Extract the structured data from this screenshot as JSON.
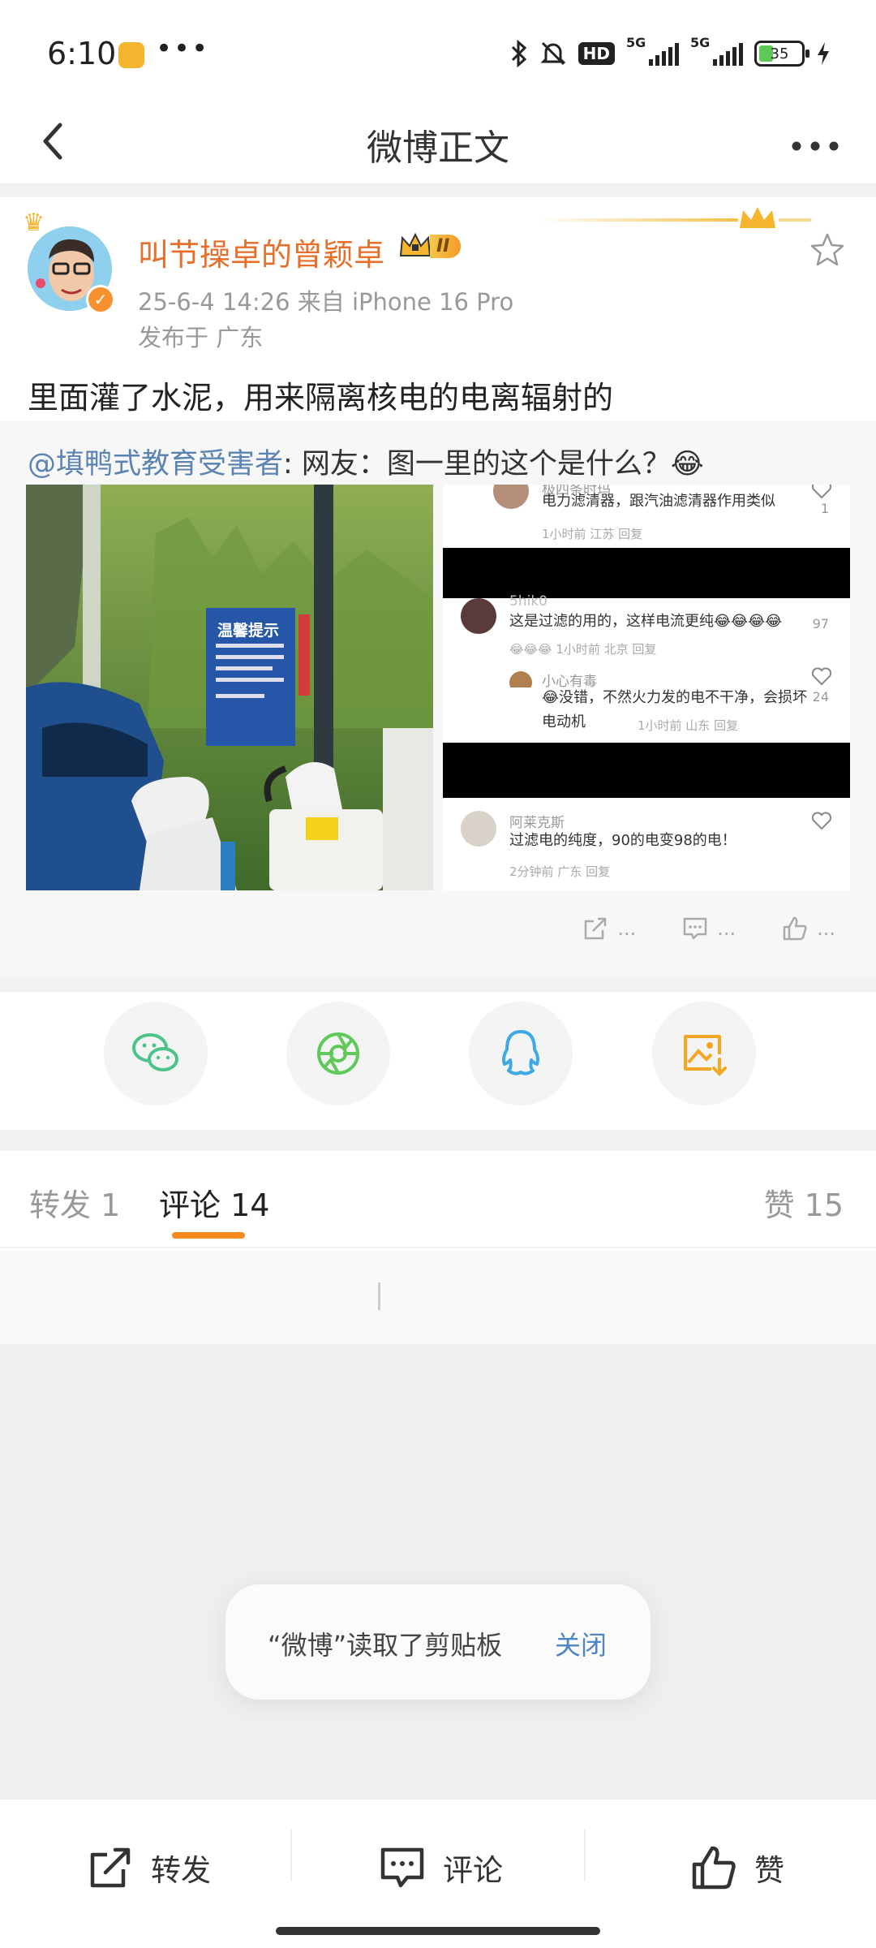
{
  "status_bar": {
    "time": "6:10",
    "dots": "•••",
    "hd": "HD",
    "signal1": "5G",
    "signal2": "5G",
    "battery": "35"
  },
  "header": {
    "title": "微博正文"
  },
  "post": {
    "author": "叫节操卓的曾颖卓",
    "level": "II",
    "meta": "25-6-4 14:26  来自 iPhone 16 Pro",
    "location": "发布于 广东",
    "text": "里面灌了水泥，用来隔离核电的电离辐射的",
    "retweet": {
      "mention": "@填鸭式教育受害者",
      "text": ": 网友：图一里的这个是什么？😂",
      "sign_text": "温馨提示",
      "screenshot": [
        {
          "name": "极四条时玛",
          "text": "电力滤清器，跟汽油滤清器作用类似",
          "time": "1小时前 江苏 回复",
          "count": "1"
        },
        {
          "name": "5hik0",
          "text": "这是过滤的用的，这样电流更纯😂😂😂😂",
          "time": "😂😂😂 1小时前 北京 回复",
          "count": "97"
        },
        {
          "name": "小心有毒",
          "text": "😂没错，不然火力发的电不干净，会损坏电动机",
          "time": "1小时前 山东 回复",
          "count": "24"
        },
        {
          "name": "阿莱克斯",
          "text": "过滤电的纯度，90的电变98的电！",
          "time": "2分钟前 广东 回复",
          "count": ""
        }
      ],
      "actions": {
        "repost": "...",
        "comment": "...",
        "like": "..."
      }
    }
  },
  "share": [
    "wechat-icon",
    "moments-icon",
    "qq-icon",
    "save-image-icon"
  ],
  "tabs": {
    "repost": "转发 1",
    "comment": "评论 14",
    "like": "赞 15"
  },
  "toast": {
    "text": "“微博”读取了剪贴板",
    "close": "关闭"
  },
  "bottom_bar": {
    "repost": "转发",
    "comment": "评论",
    "like": "赞"
  },
  "colors": {
    "accent": "#f7891e",
    "name": "#e86f2a",
    "link": "#5b84b3"
  }
}
